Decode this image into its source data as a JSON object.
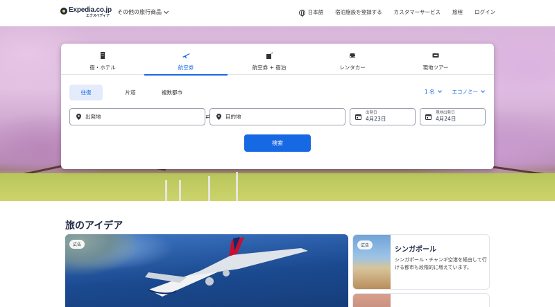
{
  "header": {
    "logo_main": "Expedia.co.jp",
    "logo_sub": "エクスペディア",
    "other_products": "その他の旅行商品",
    "language": "日本語",
    "register_property": "宿泊施設を登録する",
    "customer_service": "カスタマーサービス",
    "trips": "旅程",
    "login": "ログイン"
  },
  "search": {
    "tabs": [
      {
        "label": "宿・ホテル",
        "icon": "hotel-icon"
      },
      {
        "label": "航空券",
        "icon": "airplane-icon",
        "active": true
      },
      {
        "label": "航空券 + 宿泊",
        "icon": "flight-hotel-icon"
      },
      {
        "label": "レンタカー",
        "icon": "car-icon"
      },
      {
        "label": "現地ツアー",
        "icon": "ticket-icon"
      }
    ],
    "trip_types": [
      "往復",
      "片道",
      "複数都市"
    ],
    "travelers": "1 名",
    "cabin_class": "エコノミー",
    "origin_placeholder": "出発地",
    "destination_placeholder": "目的地",
    "depart_label": "出発日",
    "depart_value": "4月23日",
    "return_label": "現地出発日",
    "return_value": "4月24日",
    "search_button": "検索"
  },
  "ideas": {
    "title": "旅のアイデア",
    "ad_badge": "広告",
    "side_title": "シンガポール",
    "side_desc": "シンガポール・チャンギ空港を経由して行ける都市も段階的に増えています。"
  },
  "colors": {
    "brand_navy": "#1f2a44",
    "accent_blue": "#1668e3",
    "logo_yellow": "#fddb32"
  }
}
